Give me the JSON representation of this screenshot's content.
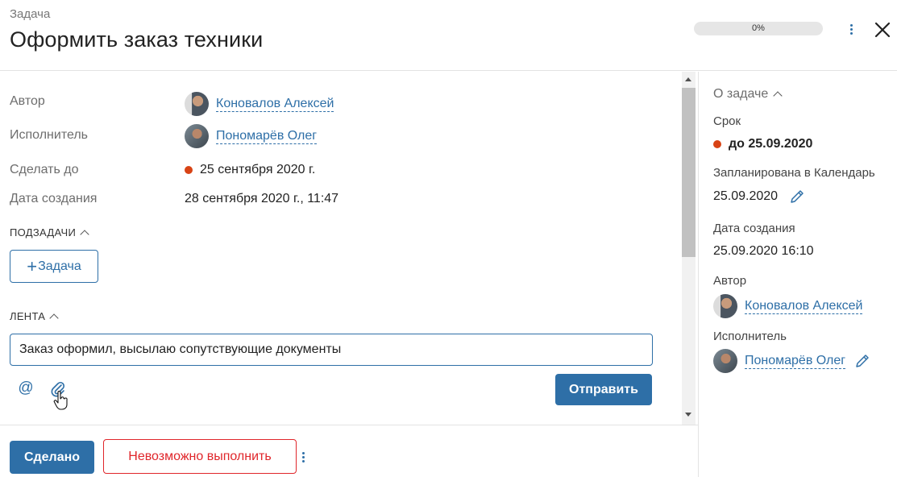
{
  "header": {
    "task_type": "Задача",
    "title": "Оформить заказ техники",
    "progress_label": "0%",
    "progress_value": 0
  },
  "fields": {
    "author_label": "Автор",
    "author_name": "Коновалов Алексей",
    "executor_label": "Исполнитель",
    "executor_name": "Пономарёв Олег",
    "due_label": "Сделать до",
    "due_value": "25 сентября 2020 г.",
    "created_label": "Дата создания",
    "created_value": "28 сентября 2020 г., 11:47"
  },
  "subtasks": {
    "title": "ПОДЗАДАЧИ",
    "add_plus": "+",
    "add_label": "Задача"
  },
  "feed": {
    "title": "ЛЕНТА",
    "input_value": "Заказ оформил, высылаю сопутствующие документы",
    "mention_glyph": "@",
    "send_label": "Отправить"
  },
  "footer": {
    "done_label": "Сделано",
    "fail_label": "Невозможно выполнить"
  },
  "side": {
    "section_title": "О задаче",
    "deadline_label": "Срок",
    "deadline_value": "до 25.09.2020",
    "calendar_label": "Запланирована в Календарь",
    "calendar_value": "25.09.2020",
    "created_label": "Дата создания",
    "created_value": "25.09.2020 16:10",
    "author_label": "Автор",
    "author_name": "Коновалов Алексей",
    "executor_label": "Исполнитель",
    "executor_name": "Пономарёв Олег"
  },
  "colors": {
    "accent": "#2e6fa7",
    "danger": "#e0262b",
    "overdue_dot": "#d84315"
  },
  "icons": [
    "kebab-menu-icon",
    "close-icon",
    "chevron-up-icon",
    "at-sign-icon",
    "paperclip-icon",
    "pencil-icon"
  ]
}
